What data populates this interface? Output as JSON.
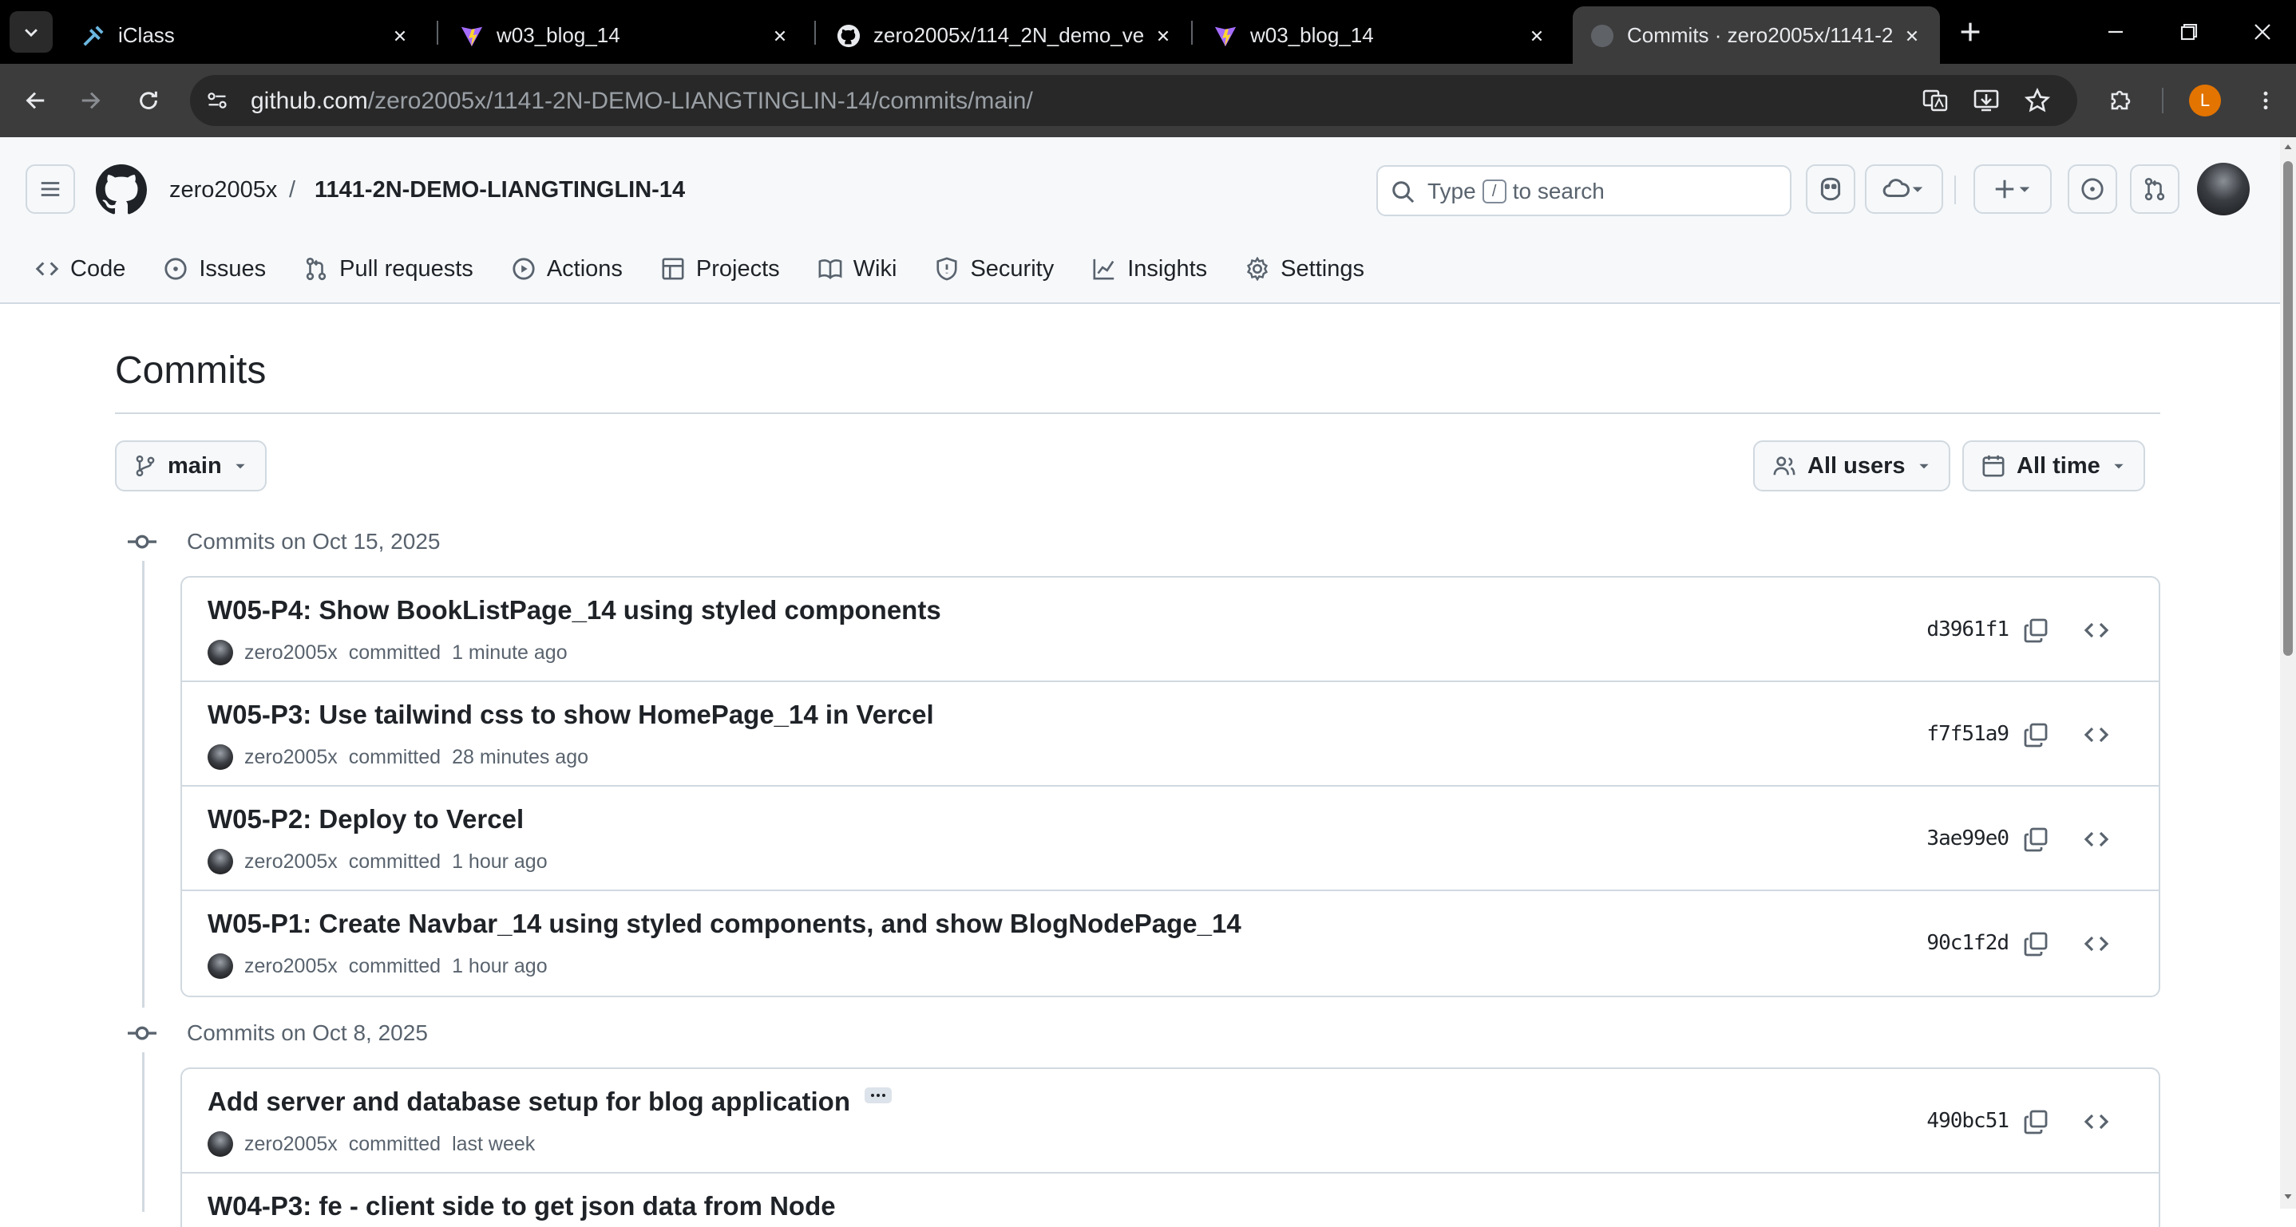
{
  "browser": {
    "tabs": [
      {
        "title": "iClass",
        "icon": "iclass-icon",
        "active": false
      },
      {
        "title": "w03_blog_14",
        "icon": "vite-icon",
        "active": false
      },
      {
        "title": "zero2005x/114_2N_demo_ve",
        "icon": "github-icon",
        "active": false
      },
      {
        "title": "w03_blog_14",
        "icon": "vite-icon",
        "active": false
      },
      {
        "title": "Commits · zero2005x/1141-2",
        "icon": "github-icon",
        "active": true
      }
    ],
    "url_host": "github.com",
    "url_path": "/zero2005x/1141-2N-DEMO-LIANGTINGLIN-14/commits/main/",
    "profile_initial": "L"
  },
  "header": {
    "owner": "zero2005x",
    "separator": "/",
    "repo": "1141-2N-DEMO-LIANGTINGLIN-14",
    "search_prefix": "Type",
    "search_key": "/",
    "search_suffix": "to search"
  },
  "repo_nav": [
    {
      "label": "Code",
      "icon": "code-icon"
    },
    {
      "label": "Issues",
      "icon": "issue-icon"
    },
    {
      "label": "Pull requests",
      "icon": "pull-request-icon"
    },
    {
      "label": "Actions",
      "icon": "play-icon"
    },
    {
      "label": "Projects",
      "icon": "table-icon"
    },
    {
      "label": "Wiki",
      "icon": "book-icon"
    },
    {
      "label": "Security",
      "icon": "shield-icon"
    },
    {
      "label": "Insights",
      "icon": "graph-icon"
    },
    {
      "label": "Settings",
      "icon": "gear-icon"
    }
  ],
  "page": {
    "title": "Commits",
    "branch": "main",
    "users_filter": "All users",
    "time_filter": "All time"
  },
  "groups": [
    {
      "heading": "Commits on Oct 15, 2025",
      "commits": [
        {
          "message": "W05-P4: Show BookListPage_14 using styled components",
          "author": "zero2005x",
          "verb": "committed",
          "when": "1 minute ago",
          "sha": "d3961f1",
          "has_more": false
        },
        {
          "message": "W05-P3: Use tailwind css to show HomePage_14 in Vercel",
          "author": "zero2005x",
          "verb": "committed",
          "when": "28 minutes ago",
          "sha": "f7f51a9",
          "has_more": false
        },
        {
          "message": "W05-P2: Deploy to Vercel",
          "author": "zero2005x",
          "verb": "committed",
          "when": "1 hour ago",
          "sha": "3ae99e0",
          "has_more": false
        },
        {
          "message": "W05-P1: Create Navbar_14 using styled components, and show BlogNodePage_14",
          "author": "zero2005x",
          "verb": "committed",
          "when": "1 hour ago",
          "sha": "90c1f2d",
          "has_more": false
        }
      ]
    },
    {
      "heading": "Commits on Oct 8, 2025",
      "commits": [
        {
          "message": "Add server and database setup for blog application",
          "author": "zero2005x",
          "verb": "committed",
          "when": "last week",
          "sha": "490bc51",
          "has_more": true
        },
        {
          "message": "W04-P3: fe - client side to get json data from Node",
          "author": "",
          "verb": "",
          "when": "",
          "sha": "",
          "has_more": false
        }
      ]
    }
  ],
  "colors": {
    "border": "#d1d9e0",
    "muted": "#59636e",
    "text": "#1f2328",
    "header_bg": "#f6f8fa"
  }
}
